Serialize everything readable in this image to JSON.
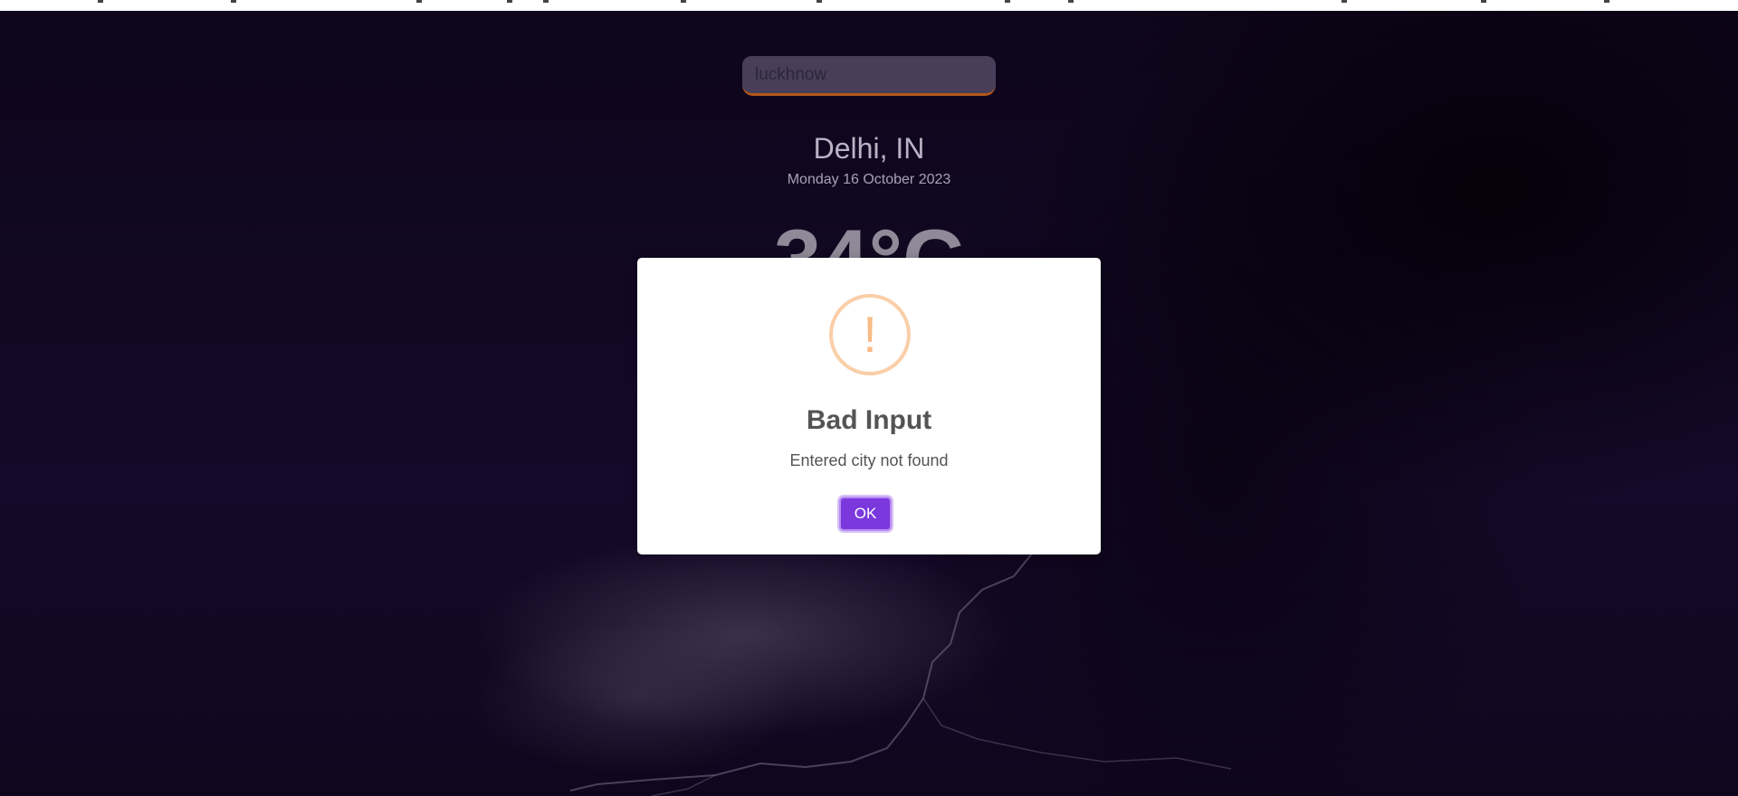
{
  "search": {
    "value": "luckhnow"
  },
  "weather": {
    "city": "Delhi, IN",
    "date": "Monday 16 October 2023",
    "temperature": "34°C"
  },
  "dialog": {
    "icon": "warning-icon",
    "icon_glyph": "!",
    "title": "Bad Input",
    "message": "Entered city not found",
    "ok_label": "OK",
    "accent_color": "#7a38dd",
    "icon_color": "#f8bb86"
  },
  "colors": {
    "search_underline": "#b3571a",
    "background": "#1d0d38"
  }
}
